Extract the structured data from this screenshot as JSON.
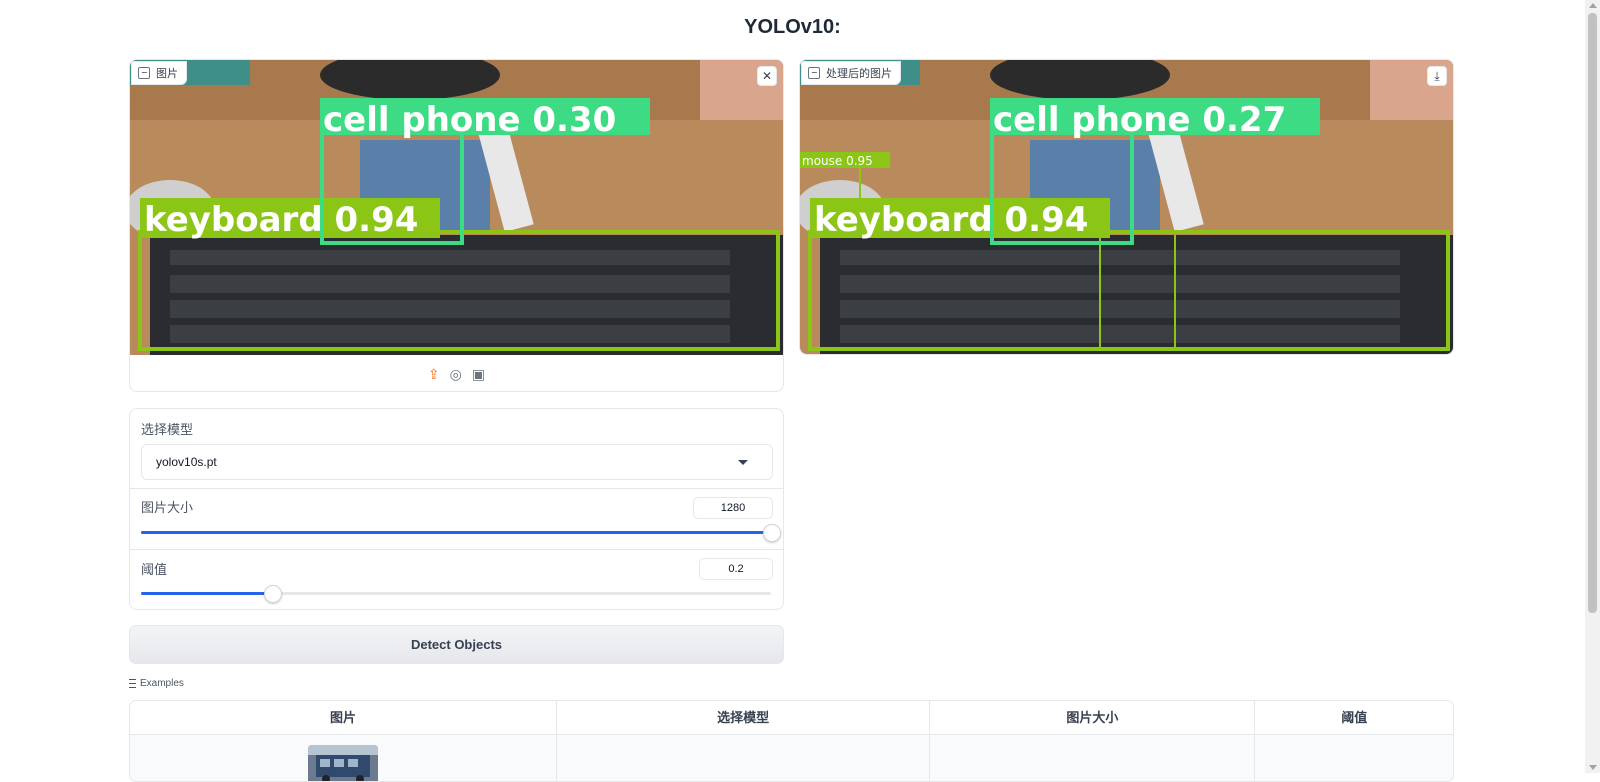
{
  "app": {
    "title": "YOLOv10:"
  },
  "input_image": {
    "label": "图片",
    "clear_icon": "close-icon",
    "source_icons": [
      "upload-icon",
      "webcam-icon",
      "clipboard-icon"
    ],
    "detections": [
      {
        "label": "cell phone 0.30",
        "class": "cell phone",
        "confidence": 0.3
      },
      {
        "label": "keyboard 0.94",
        "class": "keyboard",
        "confidence": 0.94
      }
    ]
  },
  "output_image": {
    "label": "处理后的图片",
    "download_icon": "download-icon",
    "detections": [
      {
        "label": "cell phone 0.27",
        "class": "cell phone",
        "confidence": 0.27
      },
      {
        "label": "mouse 0.95",
        "class": "mouse",
        "confidence": 0.95
      },
      {
        "label": "keyboard 0.94",
        "class": "keyboard",
        "confidence": 0.94
      }
    ]
  },
  "model_select": {
    "label": "选择模型",
    "value": "yolov10s.pt"
  },
  "image_size": {
    "label": "图片大小",
    "value": "1280",
    "fill_fraction": 1.0
  },
  "threshold": {
    "label": "阈值",
    "value": "0.2",
    "fill_fraction": 0.2
  },
  "detect_button": {
    "label": "Detect Objects"
  },
  "examples": {
    "label": "Examples",
    "headers": [
      "图片",
      "选择模型",
      "图片大小",
      "阈值"
    ]
  },
  "colors": {
    "accent": "#2563eb",
    "upload_orange": "#f97316",
    "cell_phone_box": "#3ddc84",
    "keyboard_box": "#8bc516"
  }
}
